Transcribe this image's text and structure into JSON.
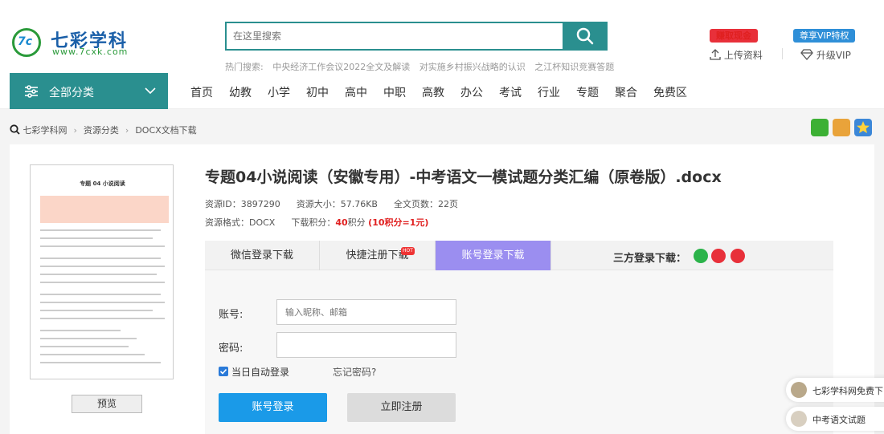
{
  "brand": {
    "name": "七彩学科",
    "url": "www.7cxk.com",
    "mark": "7c",
    "accent": "#2a8f8f"
  },
  "search": {
    "placeholder": "在这里搜索"
  },
  "hot": {
    "label": "热门搜索:",
    "items": [
      "中央经济工作会议2022全文及解读",
      "对实施乡村振兴战略的认识",
      "之江杯知识竞赛答题"
    ]
  },
  "header": {
    "earn_badge": "赚取现金",
    "vip_badge": "尊享VIP特权",
    "upload": "上传资料",
    "upgrade": "升级VIP"
  },
  "nav": {
    "all_categories": "全部分类",
    "items": [
      "首页",
      "幼教",
      "小学",
      "初中",
      "高中",
      "中职",
      "高教",
      "办公",
      "考试",
      "行业",
      "专题",
      "聚合",
      "免费区"
    ]
  },
  "breadcrumb": [
    "七彩学科网",
    "资源分类",
    "DOCX文档下载"
  ],
  "doc": {
    "title": "专题04小说阅读（安徽专用）-中考语文一模试题分类汇编（原卷版）.docx",
    "id_label": "资源ID：",
    "id": "3897290",
    "size_label": "资源大小：",
    "size": "57.76KB",
    "pages_label": "全文页数：",
    "pages": "22页",
    "format_label": "资源格式：",
    "format": "DOCX",
    "points_label": "下载积分：",
    "points": "40",
    "points_unit": "积分",
    "points_note": "(10积分=1元)",
    "thumb_title": "专题 04    小说阅读"
  },
  "preview_button": "预览",
  "tabs": {
    "wechat": "微信登录下载",
    "quick": "快捷注册下载",
    "hot_tag": "HOT",
    "account": "账号登录下载",
    "third_party": "三方登录下载："
  },
  "form": {
    "account_label": "账号:",
    "account_placeholder": "输入昵称、邮箱",
    "password_label": "密码:",
    "remember": "当日自动登录",
    "forgot": "忘记密码?",
    "login": "账号登录",
    "register": "立即注册"
  },
  "float": {
    "item1": "七彩学科网免费下",
    "item2": "中考语文试题"
  }
}
